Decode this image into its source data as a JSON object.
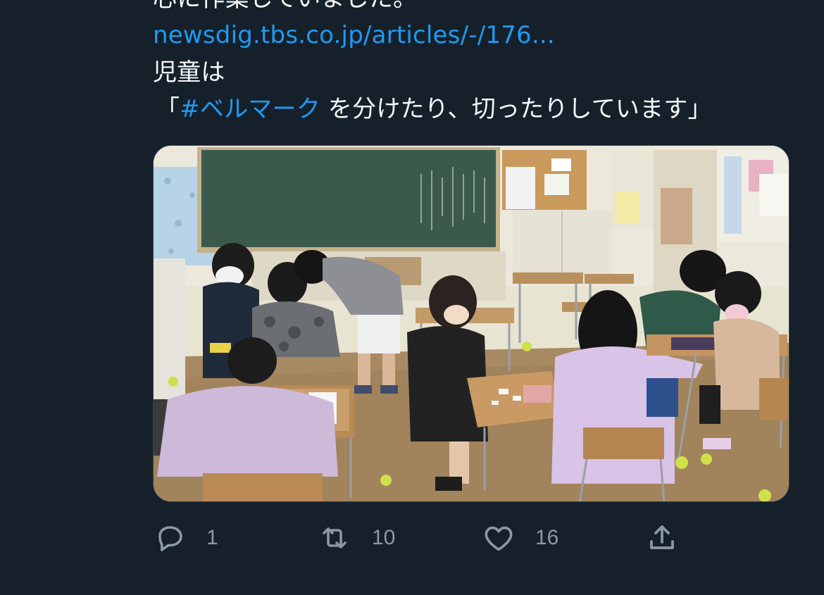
{
  "tweet": {
    "cut_line": "心に作業していました。",
    "link": "newsdig.tbs.co.jp/articles/-/176...",
    "line3": "児童は",
    "line4_open": "「",
    "hashtag": "#ベルマーク",
    "line4_rest": " を分けたり、切ったりしています」"
  },
  "media": {
    "alt": "photo of schoolchildren sorting Bellmark coupons at desks in a classroom"
  },
  "actions": {
    "reply_count": "1",
    "retweet_count": "10",
    "like_count": "16"
  },
  "icons": {
    "reply": "reply-icon",
    "retweet": "retweet-icon",
    "like": "like-icon",
    "share": "share-icon"
  },
  "colors": {
    "background": "#15202b",
    "text": "#f7f9f9",
    "link": "#1d9bf0",
    "muted": "#8b98a5"
  }
}
